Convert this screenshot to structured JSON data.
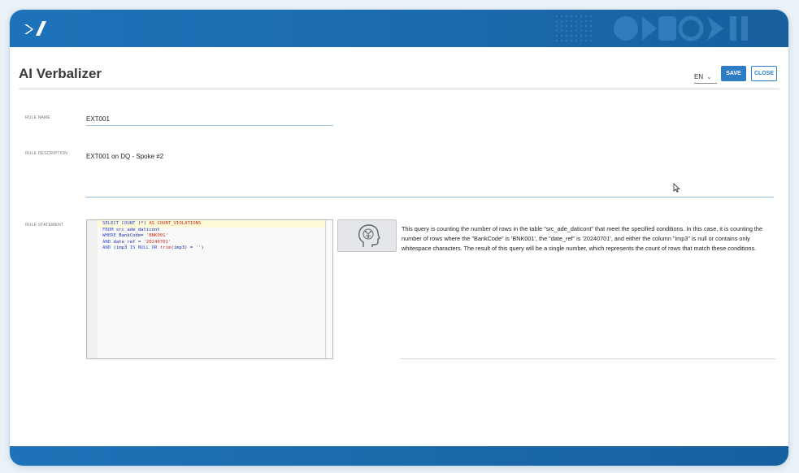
{
  "app": {
    "title": "AI Verbalizer"
  },
  "toolbar": {
    "language": "EN",
    "save_label": "SAVE",
    "close_label": "CLOSE"
  },
  "form": {
    "rule_name_label": "RULE NAME",
    "rule_name_value": "EXT001",
    "rule_description_label": "RULE DESCRIPTION",
    "rule_description_value": "EXT001 on DQ - Spoke #2",
    "rule_statement_label": "RULE STATEMENT"
  },
  "sql_code": [
    "SELECT COUNT (*) AS COUNT_VIOLATIONS",
    "FROM src_ade_daticont",
    "WHERE BankCode= 'BNK001'",
    "AND date_ref = '20240701'",
    "AND (imp3 IS NULL OR trim(imp3) = '')"
  ],
  "explanation": "This query is counting the number of rows in the table \"src_ade_daticont\" that meet the specified conditions. In this case, it is counting the number of rows where the \"BankCode\" is 'BNK001', the \"date_ref\" is '20240701', and either the column \"imp3\" is null or contains only whitespace characters. The result of this query will be a single number, which represents the count of rows that match these conditions.",
  "icons": {
    "logo": "brand-logo",
    "verbalize": "ai-head-icon",
    "cursor": "mouse-pointer-icon",
    "lang_dropdown": "chevron-down-icon"
  },
  "colors": {
    "primary": "#1e73b8",
    "button": "#2e7cc4",
    "underline": "#8fb8d8"
  }
}
